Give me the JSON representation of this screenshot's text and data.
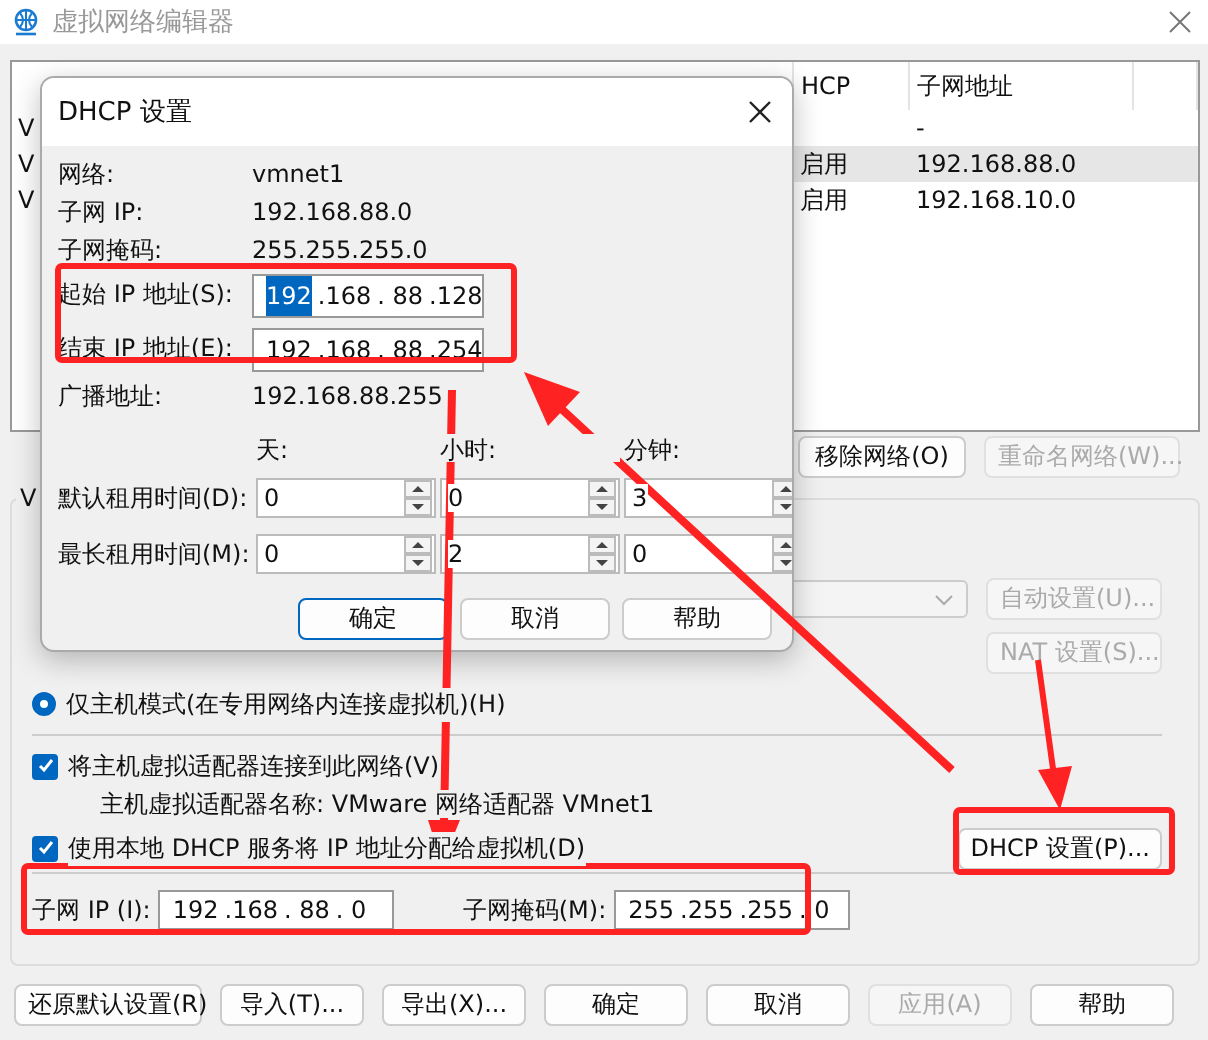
{
  "window": {
    "title": "虚拟网络编辑器"
  },
  "network_list": {
    "columns": [
      "HCP",
      "子网地址"
    ],
    "rows": [
      {
        "name": "V",
        "subnet": "-",
        "selected": false
      },
      {
        "name": "V",
        "dhcp": "启用",
        "subnet": "192.168.88.0",
        "selected": true
      },
      {
        "name": "V",
        "dhcp": "启用",
        "subnet": "192.168.10.0",
        "selected": false
      }
    ]
  },
  "list_buttons": [
    {
      "label": "移除网络(O)",
      "disabled": false
    },
    {
      "label": "重命名网络(W)...",
      "disabled": true
    }
  ],
  "vmnet_info": {
    "label": "V",
    "adapter_select": {
      "disabled": true
    },
    "auto_button": {
      "label": "自动设置(U)...",
      "disabled": true
    },
    "nat_button": {
      "label": "NAT 设置(S)...",
      "disabled": true
    },
    "host_only": {
      "label": "仅主机模式(在专用网络内连接虚拟机)(H)",
      "selected": true
    },
    "connect_adapter": {
      "label": "将主机虚拟适配器连接到此网络(V)",
      "checked": true
    },
    "adapter_name": "主机虚拟适配器名称: VMware 网络适配器 VMnet1",
    "use_dhcp": {
      "label": "使用本地 DHCP 服务将 IP 地址分配给虚拟机(D)",
      "checked": true
    },
    "dhcp_button": {
      "label": "DHCP 设置(P)...",
      "disabled": false
    },
    "subnet_ip": {
      "label": "子网 IP (I):",
      "octets": [
        "192",
        ".168",
        ". 88",
        ". 0"
      ]
    },
    "subnet_mask": {
      "label": "子网掩码(M):",
      "octets": [
        "255",
        ".255",
        ".255",
        ". 0"
      ]
    }
  },
  "footer_buttons": [
    {
      "label": "还原默认设置(R)",
      "disabled": false
    },
    {
      "label": "导入(T)...",
      "disabled": false
    },
    {
      "label": "导出(X)...",
      "disabled": false
    },
    {
      "label": "确定",
      "disabled": false
    },
    {
      "label": "取消",
      "disabled": false
    },
    {
      "label": "应用(A)",
      "disabled": true
    },
    {
      "label": "帮助",
      "disabled": false
    }
  ],
  "dhcp_dialog": {
    "title": "DHCP 设置",
    "info": [
      {
        "label": "网络:",
        "value": "vmnet1"
      },
      {
        "label": "子网 IP:",
        "value": "192.168.88.0"
      },
      {
        "label": "子网掩码:",
        "value": "255.255.255.0"
      }
    ],
    "range": [
      {
        "label": "起始 IP 地址(S):",
        "octets": [
          {
            "text": "192",
            "selected": true
          },
          {
            "text": ".168",
            "selected": false
          },
          {
            "text": ". 88",
            "selected": false
          },
          {
            "text": ".128",
            "selected": false
          }
        ]
      },
      {
        "label": "结束 IP 地址(E):",
        "octets": [
          {
            "text": "192",
            "selected": false
          },
          {
            "text": ".168",
            "selected": false
          },
          {
            "text": ". 88",
            "selected": false
          },
          {
            "text": ".254",
            "selected": false
          }
        ]
      }
    ],
    "broadcast": {
      "label": "广播地址:",
      "value": "192.168.88.255"
    },
    "lease": {
      "headers": [
        "天:",
        "小时:",
        "分钟:"
      ],
      "rows": [
        {
          "label": "默认租用时间(D):",
          "values": [
            "0",
            "0",
            "3"
          ]
        },
        {
          "label": "最长租用时间(M):",
          "values": [
            "0",
            "2",
            "0"
          ]
        }
      ]
    },
    "buttons": [
      {
        "label": "确定",
        "default": true
      },
      {
        "label": "取消",
        "default": false
      },
      {
        "label": "帮助",
        "default": false
      }
    ]
  }
}
